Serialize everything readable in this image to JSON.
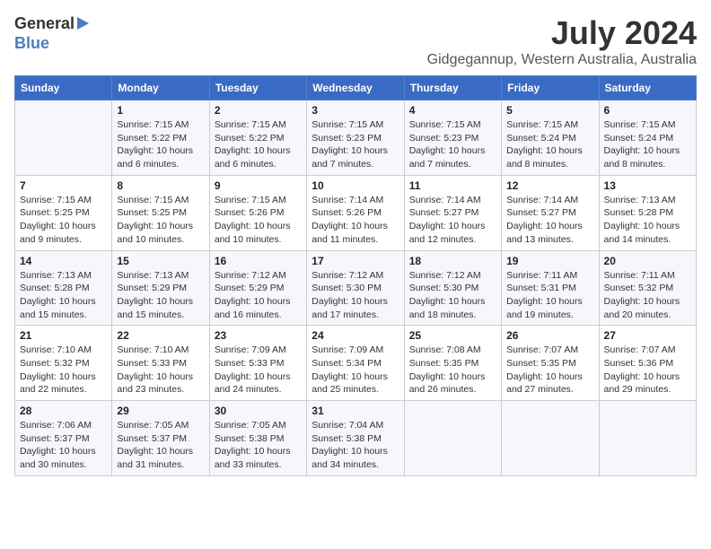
{
  "logo": {
    "line1": "General",
    "line2": "Blue"
  },
  "title": "July 2024",
  "subtitle": "Gidgegannup, Western Australia, Australia",
  "days": [
    "Sunday",
    "Monday",
    "Tuesday",
    "Wednesday",
    "Thursday",
    "Friday",
    "Saturday"
  ],
  "weeks": [
    [
      {
        "date": "",
        "text": ""
      },
      {
        "date": "1",
        "text": "Sunrise: 7:15 AM\nSunset: 5:22 PM\nDaylight: 10 hours\nand 6 minutes."
      },
      {
        "date": "2",
        "text": "Sunrise: 7:15 AM\nSunset: 5:22 PM\nDaylight: 10 hours\nand 6 minutes."
      },
      {
        "date": "3",
        "text": "Sunrise: 7:15 AM\nSunset: 5:23 PM\nDaylight: 10 hours\nand 7 minutes."
      },
      {
        "date": "4",
        "text": "Sunrise: 7:15 AM\nSunset: 5:23 PM\nDaylight: 10 hours\nand 7 minutes."
      },
      {
        "date": "5",
        "text": "Sunrise: 7:15 AM\nSunset: 5:24 PM\nDaylight: 10 hours\nand 8 minutes."
      },
      {
        "date": "6",
        "text": "Sunrise: 7:15 AM\nSunset: 5:24 PM\nDaylight: 10 hours\nand 8 minutes."
      }
    ],
    [
      {
        "date": "7",
        "text": "Sunrise: 7:15 AM\nSunset: 5:25 PM\nDaylight: 10 hours\nand 9 minutes."
      },
      {
        "date": "8",
        "text": "Sunrise: 7:15 AM\nSunset: 5:25 PM\nDaylight: 10 hours\nand 10 minutes."
      },
      {
        "date": "9",
        "text": "Sunrise: 7:15 AM\nSunset: 5:26 PM\nDaylight: 10 hours\nand 10 minutes."
      },
      {
        "date": "10",
        "text": "Sunrise: 7:14 AM\nSunset: 5:26 PM\nDaylight: 10 hours\nand 11 minutes."
      },
      {
        "date": "11",
        "text": "Sunrise: 7:14 AM\nSunset: 5:27 PM\nDaylight: 10 hours\nand 12 minutes."
      },
      {
        "date": "12",
        "text": "Sunrise: 7:14 AM\nSunset: 5:27 PM\nDaylight: 10 hours\nand 13 minutes."
      },
      {
        "date": "13",
        "text": "Sunrise: 7:13 AM\nSunset: 5:28 PM\nDaylight: 10 hours\nand 14 minutes."
      }
    ],
    [
      {
        "date": "14",
        "text": "Sunrise: 7:13 AM\nSunset: 5:28 PM\nDaylight: 10 hours\nand 15 minutes."
      },
      {
        "date": "15",
        "text": "Sunrise: 7:13 AM\nSunset: 5:29 PM\nDaylight: 10 hours\nand 15 minutes."
      },
      {
        "date": "16",
        "text": "Sunrise: 7:12 AM\nSunset: 5:29 PM\nDaylight: 10 hours\nand 16 minutes."
      },
      {
        "date": "17",
        "text": "Sunrise: 7:12 AM\nSunset: 5:30 PM\nDaylight: 10 hours\nand 17 minutes."
      },
      {
        "date": "18",
        "text": "Sunrise: 7:12 AM\nSunset: 5:30 PM\nDaylight: 10 hours\nand 18 minutes."
      },
      {
        "date": "19",
        "text": "Sunrise: 7:11 AM\nSunset: 5:31 PM\nDaylight: 10 hours\nand 19 minutes."
      },
      {
        "date": "20",
        "text": "Sunrise: 7:11 AM\nSunset: 5:32 PM\nDaylight: 10 hours\nand 20 minutes."
      }
    ],
    [
      {
        "date": "21",
        "text": "Sunrise: 7:10 AM\nSunset: 5:32 PM\nDaylight: 10 hours\nand 22 minutes."
      },
      {
        "date": "22",
        "text": "Sunrise: 7:10 AM\nSunset: 5:33 PM\nDaylight: 10 hours\nand 23 minutes."
      },
      {
        "date": "23",
        "text": "Sunrise: 7:09 AM\nSunset: 5:33 PM\nDaylight: 10 hours\nand 24 minutes."
      },
      {
        "date": "24",
        "text": "Sunrise: 7:09 AM\nSunset: 5:34 PM\nDaylight: 10 hours\nand 25 minutes."
      },
      {
        "date": "25",
        "text": "Sunrise: 7:08 AM\nSunset: 5:35 PM\nDaylight: 10 hours\nand 26 minutes."
      },
      {
        "date": "26",
        "text": "Sunrise: 7:07 AM\nSunset: 5:35 PM\nDaylight: 10 hours\nand 27 minutes."
      },
      {
        "date": "27",
        "text": "Sunrise: 7:07 AM\nSunset: 5:36 PM\nDaylight: 10 hours\nand 29 minutes."
      }
    ],
    [
      {
        "date": "28",
        "text": "Sunrise: 7:06 AM\nSunset: 5:37 PM\nDaylight: 10 hours\nand 30 minutes."
      },
      {
        "date": "29",
        "text": "Sunrise: 7:05 AM\nSunset: 5:37 PM\nDaylight: 10 hours\nand 31 minutes."
      },
      {
        "date": "30",
        "text": "Sunrise: 7:05 AM\nSunset: 5:38 PM\nDaylight: 10 hours\nand 33 minutes."
      },
      {
        "date": "31",
        "text": "Sunrise: 7:04 AM\nSunset: 5:38 PM\nDaylight: 10 hours\nand 34 minutes."
      },
      {
        "date": "",
        "text": ""
      },
      {
        "date": "",
        "text": ""
      },
      {
        "date": "",
        "text": ""
      }
    ]
  ]
}
